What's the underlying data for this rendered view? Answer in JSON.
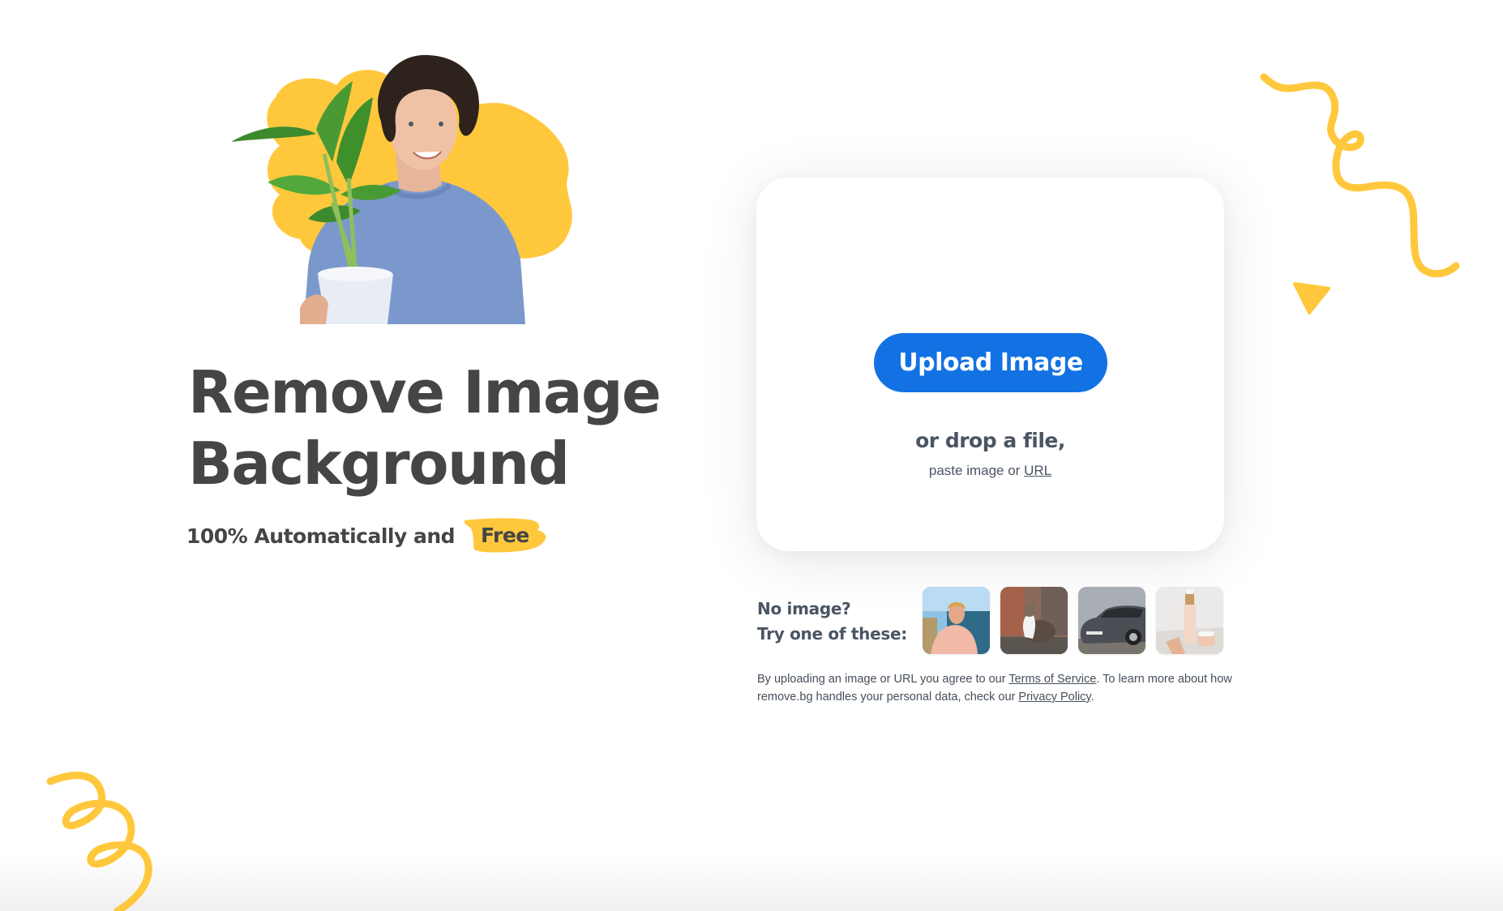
{
  "hero": {
    "headline_line1": "Remove Image",
    "headline_line2": "Background",
    "subtitle_prefix": "100% Automatically and",
    "subtitle_highlight": "Free",
    "image_alt": "Man holding a potted plant on yellow blob background"
  },
  "upload": {
    "button_label": "Upload Image",
    "drop_text": "or drop a file,",
    "paste_prefix": "paste image or",
    "url_link": "URL"
  },
  "samples": {
    "label_line1": "No image?",
    "label_line2": "Try one of these:",
    "items": [
      {
        "name": "person",
        "alt": "Man in pink t-shirt"
      },
      {
        "name": "cat",
        "alt": "Tabby cat sitting"
      },
      {
        "name": "car",
        "alt": "Gray car"
      },
      {
        "name": "cosmetics",
        "alt": "Cosmetic bottles"
      }
    ]
  },
  "legal": {
    "part1": "By uploading an image or URL you agree to our",
    "terms_link": "Terms of Service",
    "part2": ". To learn more about how remove.bg handles your personal data, check our",
    "privacy_link": "Privacy Policy",
    "part3": "."
  },
  "colors": {
    "accent_blue": "#1272e3",
    "brand_yellow": "#ffc83c",
    "heading_text": "#454545",
    "body_text": "#4a5563"
  }
}
